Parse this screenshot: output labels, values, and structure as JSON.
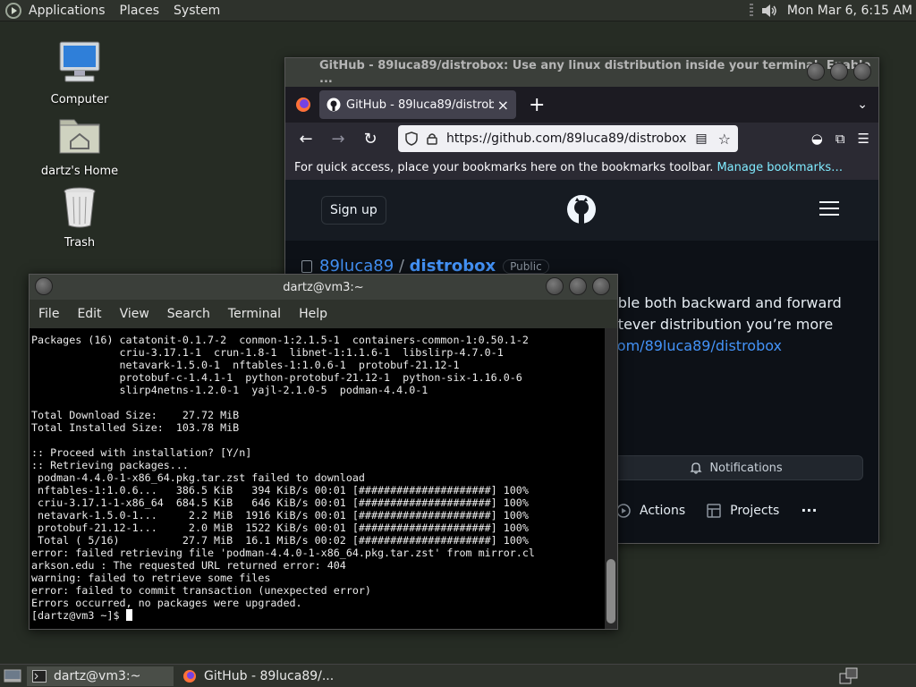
{
  "top_panel": {
    "menus": [
      "Applications",
      "Places",
      "System"
    ],
    "clock": "Mon Mar  6,  6:15 AM"
  },
  "desktop": {
    "icons": [
      {
        "label": "Computer"
      },
      {
        "label": "dartz's Home"
      },
      {
        "label": "Trash"
      }
    ]
  },
  "firefox": {
    "window_title": "GitHub - 89luca89/distrobox: Use any linux distribution inside your terminal. Enable ...",
    "tab_label": "GitHub - 89luca89/distrobox",
    "tab_close": "×",
    "new_tab": "+",
    "url": "https://github.com/89luca89/distrobox",
    "bookmarks_text": "For quick access, place your bookmarks here on the bookmarks toolbar.",
    "bookmarks_link": "Manage bookmarks…",
    "page": {
      "signup": "Sign up",
      "repo_owner": "89luca89",
      "repo_sep": " / ",
      "repo_name": "distrobox",
      "badge": "Public",
      "desc_line1": "able both backward and forward",
      "desc_line2": "atever distribution you’re more",
      "desc_link": "com/89luca89/distrobox",
      "notifications": "Notifications",
      "tab_actions": "Actions",
      "tab_projects": "Projects",
      "more": "···"
    }
  },
  "terminal": {
    "title": "dartz@vm3:~",
    "menu": [
      "File",
      "Edit",
      "View",
      "Search",
      "Terminal",
      "Help"
    ],
    "lines": [
      "Packages (16) catatonit-0.1.7-2  conmon-1:2.1.5-1  containers-common-1:0.50.1-2",
      "              criu-3.17.1-1  crun-1.8-1  libnet-1:1.1.6-1  libslirp-4.7.0-1",
      "              netavark-1.5.0-1  nftables-1:1.0.6-1  protobuf-21.12-1",
      "              protobuf-c-1.4.1-1  python-protobuf-21.12-1  python-six-1.16.0-6",
      "              slirp4netns-1.2.0-1  yajl-2.1.0-5  podman-4.4.0-1",
      "",
      "Total Download Size:    27.72 MiB",
      "Total Installed Size:  103.78 MiB",
      "",
      ":: Proceed with installation? [Y/n]",
      ":: Retrieving packages...",
      " podman-4.4.0-1-x86_64.pkg.tar.zst failed to download",
      " nftables-1:1.0.6...   386.5 KiB   394 KiB/s 00:01 [#####################] 100%",
      " criu-3.17.1-1-x86_64  684.5 KiB   646 KiB/s 00:01 [#####################] 100%",
      " netavark-1.5.0-1...     2.2 MiB  1916 KiB/s 00:01 [#####################] 100%",
      " protobuf-21.12-1...     2.0 MiB  1522 KiB/s 00:01 [#####################] 100%",
      " Total ( 5/16)          27.7 MiB  16.1 MiB/s 00:02 [#####################] 100%",
      "error: failed retrieving file 'podman-4.4.0-1-x86_64.pkg.tar.zst' from mirror.cl",
      "arkson.edu : The requested URL returned error: 404",
      "warning: failed to retrieve some files",
      "error: failed to commit transaction (unexpected error)",
      "Errors occurred, no packages were upgraded."
    ],
    "prompt": "[dartz@vm3 ~]$ "
  },
  "bottom_panel": {
    "tasks": [
      {
        "label": "dartz@vm3:~"
      },
      {
        "label": "GitHub - 89luca89/..."
      }
    ]
  }
}
